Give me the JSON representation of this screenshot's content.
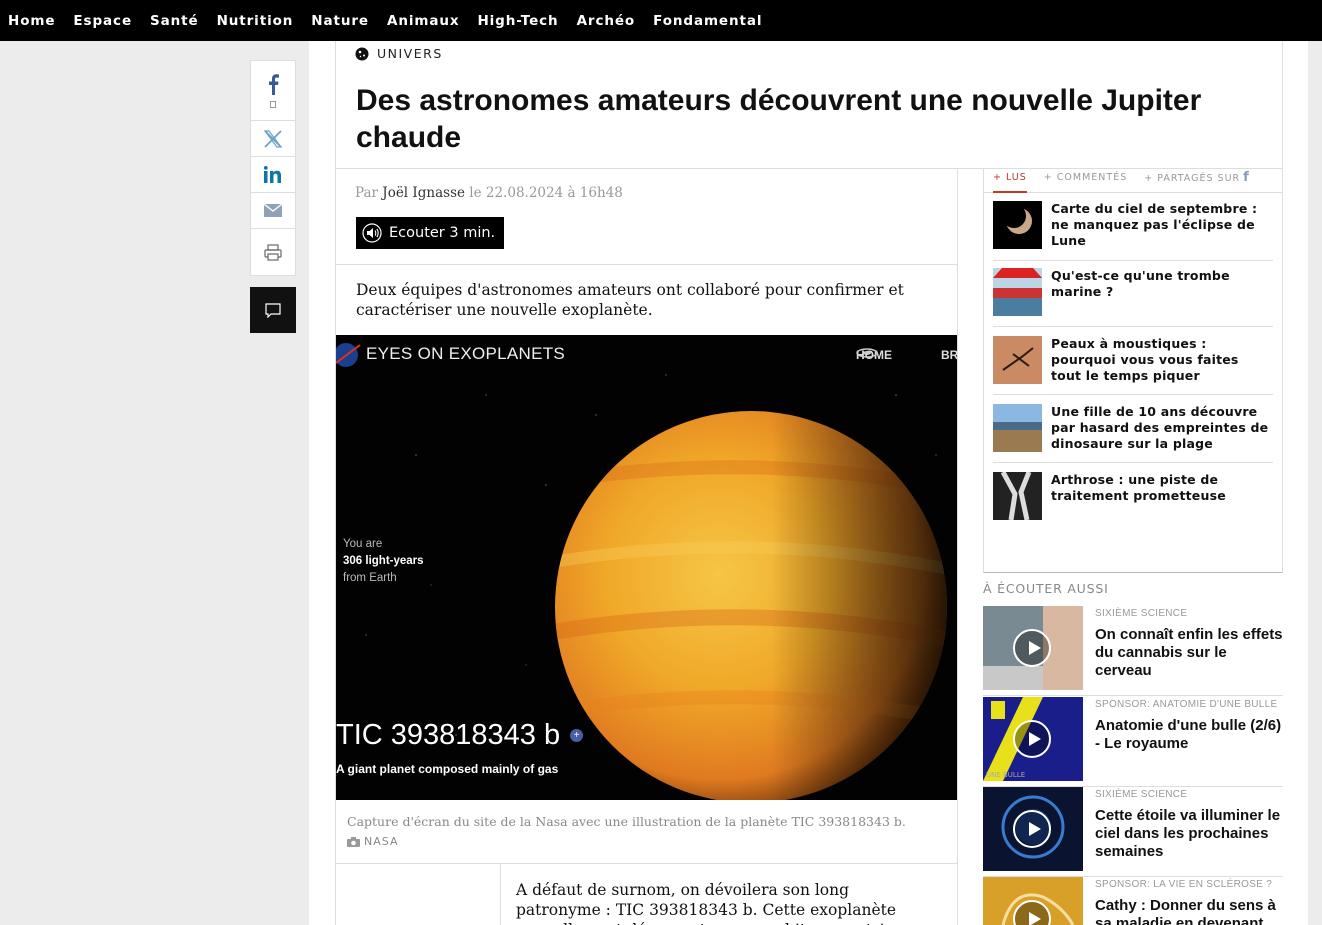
{
  "nav": {
    "items": [
      "Home",
      "Espace",
      "Santé",
      "Nutrition",
      "Nature",
      "Animaux",
      "High-Tech",
      "Archéo",
      "Fondamental"
    ]
  },
  "article": {
    "rubric": "UNIVERS",
    "title": "Des astronomes amateurs découvrent une nouvelle Jupiter chaude",
    "byline_prefix": "Par",
    "author": "Joël Ignasse",
    "byline_date": "le 22.08.2024 à 16h48",
    "listen_label": "Ecouter 3 min.",
    "chapo": "Deux équipes d'astronomes amateurs ont collaboré pour confirmer et caractériser une nouvelle exoplanète.",
    "caption": "Capture d'écran du site de la Nasa avec une illustration de la planète TIC 393818343 b.",
    "credit": "NASA",
    "body": "A défaut de surnom, on dévoilera son long patronyme : TIC 393818343 b. Cette exoplanète nouvellement découverte a une orbite excentrique autour de son étoile"
  },
  "hero": {
    "nasa_logo": "NASA",
    "brand": "EYES ON EXOPLANETS",
    "home": "HOME",
    "br": "BR",
    "dist_line1": "You are",
    "dist_line2": "306 light-years",
    "dist_line3": "from Earth",
    "planet_name": "TIC 393818343 b",
    "planet_desc": "A giant planet composed mainly of gas"
  },
  "sidebar": {
    "tabs": [
      "+ LUS",
      "+ COMMENTÉS",
      "+ PARTAGÉS SUR"
    ],
    "popular": [
      {
        "title": "Carte du ciel de septembre : ne manquez pas l'éclipse de Lune"
      },
      {
        "title": "Qu'est-ce qu'une trombe marine ?"
      },
      {
        "title": "Peaux à moustiques : pourquoi vous vous faites tout le temps piquer"
      },
      {
        "title": "Une fille de 10 ans découvre par hasard des empreintes de dinosaure sur la plage"
      },
      {
        "title": "Arthrose : une piste de traitement prometteuse"
      }
    ],
    "listen_heading": "À ÉCOUTER AUSSI",
    "podcasts": [
      {
        "kicker": "SIXIÈME SCIENCE",
        "title": "On connaît enfin les effets du cannabis sur le cerveau"
      },
      {
        "kicker": "SPONSOR: ANATOMIE D'UNE BULLE",
        "title": "Anatomie d'une bulle (2/6) - Le royaume",
        "cover_text": "UNE BULLE"
      },
      {
        "kicker": "SIXIÈME SCIENCE",
        "title": "Cette étoile va illuminer le ciel dans les prochaines semaines"
      },
      {
        "kicker": "SPONSOR: LA VIE EN SCLÉROSE ?",
        "title": "Cathy : Donner du sens à sa maladie en devenant"
      }
    ]
  },
  "colors": {
    "accent": "#c0392b",
    "nav_bg": "#000000",
    "planet": "#f0a020"
  }
}
